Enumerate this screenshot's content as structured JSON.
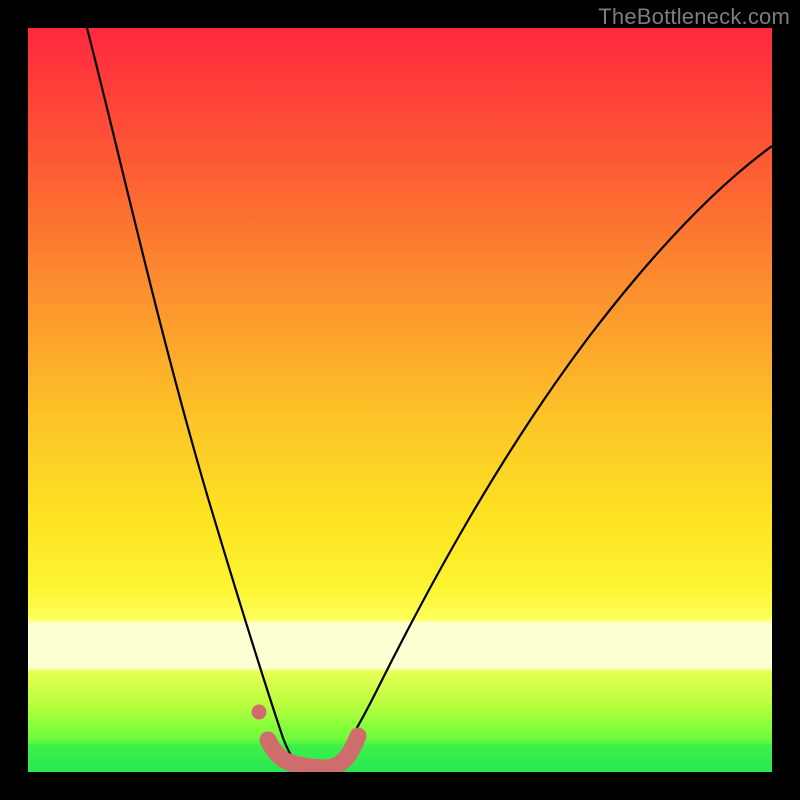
{
  "attribution": "TheBottleneck.com",
  "colors": {
    "gradient_top": "#fe293e",
    "gradient_mid_upper": "#fc8a2f",
    "gradient_mid": "#fde323",
    "gradient_mid_lower": "#fdfb36",
    "gradient_lower": "#e4ff4a",
    "gradient_band": "#ffffd4",
    "gradient_bottom": "#27e852",
    "curve": "#000000",
    "marker": "#cf6c6c",
    "frame": "#000000"
  },
  "chart_data": {
    "type": "line",
    "title": "",
    "xlabel": "",
    "ylabel": "",
    "xlim": [
      0,
      100
    ],
    "ylim": [
      0,
      100
    ],
    "series": [
      {
        "name": "left-curve",
        "x": [
          8,
          10,
          12,
          15,
          18,
          21,
          24,
          27,
          29,
          31,
          33,
          34,
          35
        ],
        "y": [
          100,
          90,
          80,
          66,
          54,
          42,
          32,
          22,
          15,
          9,
          5,
          3,
          2
        ]
      },
      {
        "name": "right-curve",
        "x": [
          40,
          42,
          45,
          49,
          54,
          60,
          67,
          75,
          83,
          91,
          100
        ],
        "y": [
          2,
          4,
          8,
          14,
          22,
          32,
          42,
          52,
          60,
          68,
          75
        ]
      },
      {
        "name": "bottom-markers",
        "x": [
          32.5,
          34,
          35.5,
          37,
          38.5,
          40,
          41.5,
          43
        ],
        "y": [
          3.5,
          2,
          1.5,
          1.5,
          1.5,
          1.5,
          2,
          3.5
        ]
      },
      {
        "name": "isolated-marker",
        "x": [
          31
        ],
        "y": [
          8
        ]
      }
    ]
  }
}
